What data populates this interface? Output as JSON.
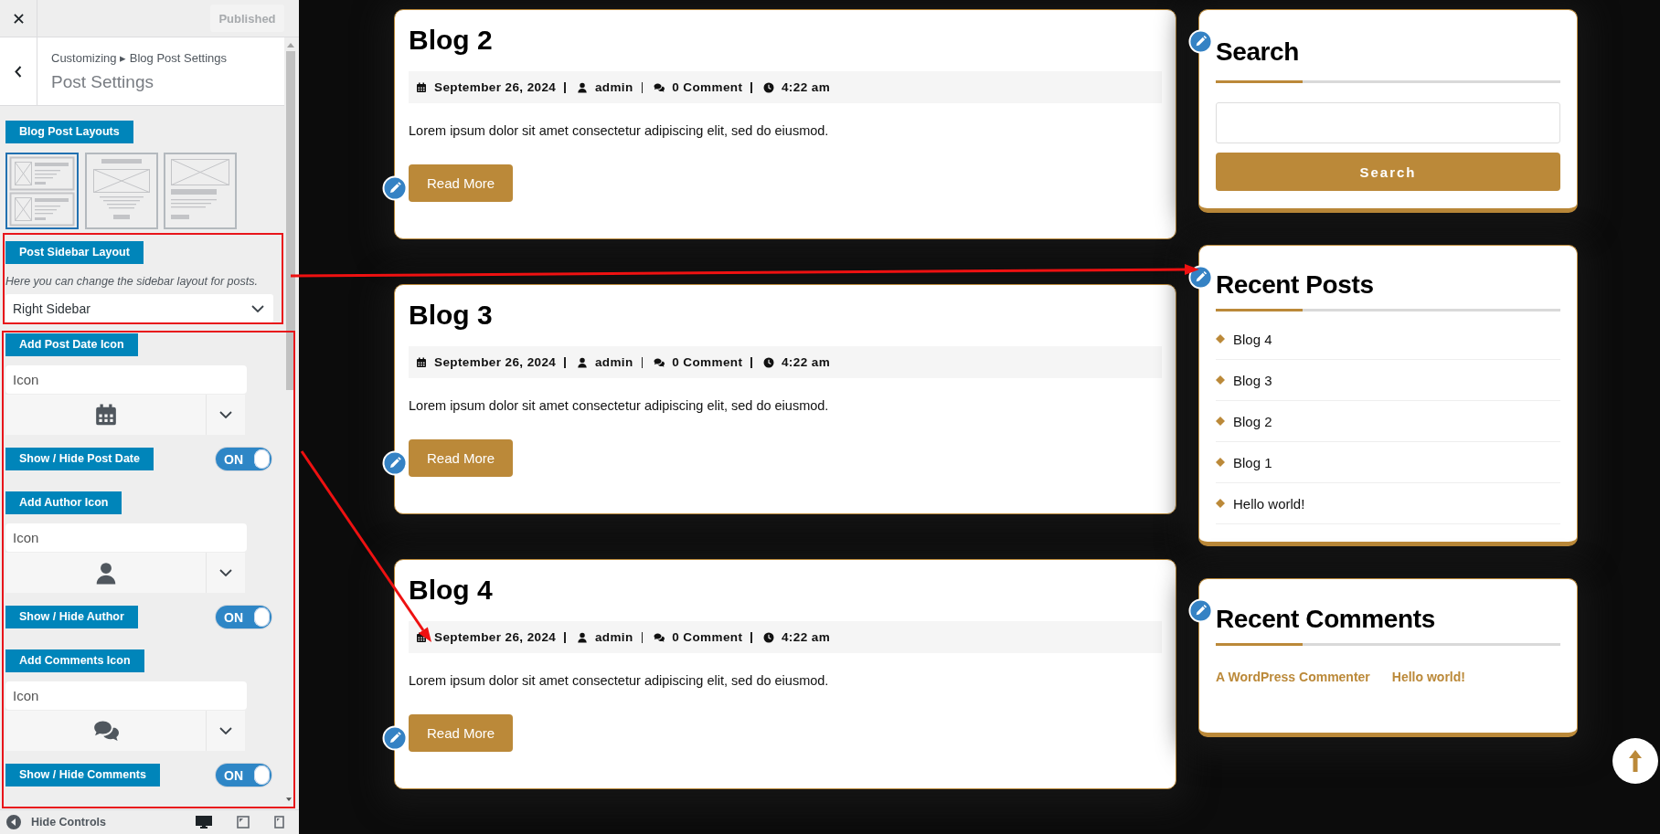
{
  "customizer": {
    "publish_button": {
      "label": "Published",
      "disabled": true
    },
    "breadcrumb": "Customizing ▸ Blog Post Settings",
    "title": "Post Settings",
    "sections": [
      {
        "highlighted": false,
        "controls": [
          {
            "kind": "layouts",
            "label": "Blog Post Layouts",
            "options": [
              {
                "kind": "two-row",
                "selected": true
              },
              {
                "kind": "centered",
                "selected": false
              },
              {
                "kind": "full-width",
                "selected": false
              }
            ]
          }
        ]
      },
      {
        "highlighted": true,
        "controls": [
          {
            "kind": "select",
            "label": "Post Sidebar Layout",
            "description": "Here you can change the sidebar layout for posts.",
            "value": "Right Sidebar"
          }
        ]
      },
      {
        "highlighted": true,
        "controls": [
          {
            "kind": "icon_picker",
            "label": "Add Post Date Icon",
            "placeholder": "Icon",
            "preview": {
              "kind": "date"
            }
          },
          {
            "kind": "toggle",
            "label": "Show / Hide Post Date",
            "on": true,
            "state_label": "ON"
          },
          {
            "kind": "icon_picker",
            "label": "Add Author Icon",
            "placeholder": "Icon",
            "preview": {
              "kind": "author"
            }
          },
          {
            "kind": "toggle",
            "label": "Show / Hide Author",
            "on": true,
            "state_label": "ON"
          },
          {
            "kind": "icon_picker",
            "label": "Add Comments Icon",
            "placeholder": "Icon",
            "preview": {
              "kind": "comments"
            }
          },
          {
            "kind": "toggle",
            "label": "Show / Hide Comments",
            "on": true,
            "state_label": "ON"
          }
        ]
      }
    ],
    "footer": {
      "label": "Hide Controls",
      "devices": [
        {
          "kind": "desktop",
          "selected": true
        },
        {
          "kind": "tablet",
          "selected": false
        },
        {
          "kind": "mobile",
          "selected": false
        }
      ]
    }
  },
  "posts": [
    {
      "title": "Blog 2",
      "meta": [
        {
          "kind": "date",
          "text": "September 26, 2024"
        },
        {
          "kind": "author",
          "text": "admin"
        },
        {
          "kind": "comments",
          "text": "0 Comment"
        },
        {
          "kind": "time",
          "text": "4:22 am"
        }
      ],
      "excerpt": "Lorem ipsum dolor sit amet consectetur adipiscing elit, sed do eiusmod.",
      "button": "Read More"
    },
    {
      "title": "Blog 3",
      "meta": [
        {
          "kind": "date",
          "text": "September 26, 2024"
        },
        {
          "kind": "author",
          "text": "admin"
        },
        {
          "kind": "comments",
          "text": "0 Comment"
        },
        {
          "kind": "time",
          "text": "4:22 am"
        }
      ],
      "excerpt": "Lorem ipsum dolor sit amet consectetur adipiscing elit, sed do eiusmod.",
      "button": "Read More"
    },
    {
      "title": "Blog 4",
      "meta": [
        {
          "kind": "date",
          "text": "September 26, 2024"
        },
        {
          "kind": "author",
          "text": "admin"
        },
        {
          "kind": "comments",
          "text": "0 Comment"
        },
        {
          "kind": "time",
          "text": "4:22 am"
        }
      ],
      "excerpt": "Lorem ipsum dolor sit amet consectetur adipiscing elit, sed do eiusmod.",
      "button": "Read More"
    }
  ],
  "sidebar": [
    {
      "kind": "search",
      "title": "Search",
      "button": "Search"
    },
    {
      "kind": "posts",
      "title": "Recent Posts",
      "items": [
        "Blog 4",
        "Blog 3",
        "Blog 2",
        "Blog 1",
        "Hello world!"
      ]
    },
    {
      "kind": "comments",
      "title": "Recent Comments",
      "links": [
        "A WordPress Commenter",
        "Hello world!"
      ]
    }
  ]
}
